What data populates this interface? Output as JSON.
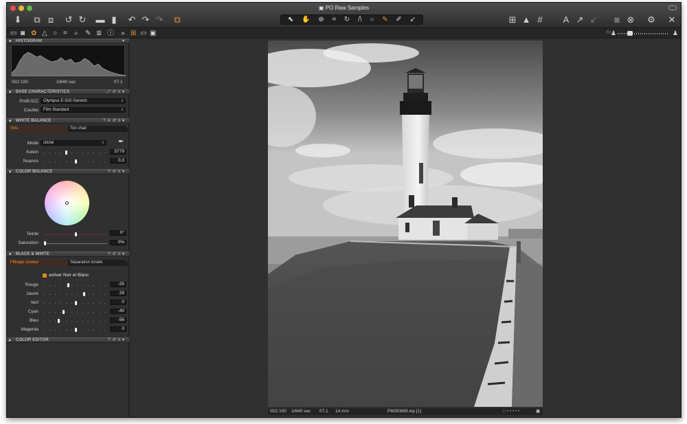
{
  "window": {
    "title": "PO Raw Samples",
    "doc_icon": "document-icon"
  },
  "toolbar": {
    "left_icons": [
      "import-icon",
      "capture-icon",
      "capture-pilot-icon",
      "rotate-left-icon",
      "rotate-right-icon",
      "new-folder-icon",
      "trash-icon",
      "undo-icon",
      "redo-icon",
      "redo-dim-icon",
      "process-icon"
    ],
    "cursor_tools": [
      "select-icon",
      "pan-icon",
      "zoom-icon",
      "crop-icon",
      "rotate-tool-icon",
      "keystone-icon",
      "spot-icon",
      "brush-icon",
      "eraser-icon",
      "picker-icon"
    ],
    "right_icons": [
      "grid-icon",
      "exposure-warning-icon",
      "grid-lines-icon",
      "text-icon",
      "arrow-up-icon",
      "arrow-down-icon",
      "camera-icon",
      "cancel-icon",
      "settings-icon",
      "tools-icon"
    ]
  },
  "toolstrip": {
    "tab_icons": [
      "folder-icon",
      "camera-tab-icon",
      "color-tab-icon",
      "exposure-tab-icon",
      "lens-tab-icon",
      "crop-tab-icon",
      "focus-tab-icon",
      "detail-tab-icon",
      "metadata-tab-icon",
      "info-tab-icon"
    ],
    "fit_label": "Fit",
    "accent": "#e6952d"
  },
  "histogram": {
    "title": "HISTOGRAM",
    "iso": "ISO 100",
    "shutter": "1/640 sec",
    "aperture": "f/7.1"
  },
  "base": {
    "title": "BASE CHARACTERISTICS",
    "icc_label": "Profil ICC",
    "icc_value": "Olympus E-520 Generic",
    "curve_label": "Courbe",
    "curve_value": "Film Standard"
  },
  "wb": {
    "title": "WHITE BALANCE",
    "tab_active": "Gris",
    "tab_inactive": "Ton chair",
    "mode_label": "Mode",
    "mode_value": "cliché",
    "kelvin_label": "Kelvin",
    "kelvin_value": "5779",
    "kelvin_level": 0.35,
    "nuance_label": "Nuance",
    "nuance_value": "0,3",
    "nuance_level": 0.5
  },
  "cb": {
    "title": "COLOR BALANCE",
    "teinte_label": "Teinte",
    "teinte_value": "0°",
    "teinte_level": 0.5,
    "saturation_label": "Saturation",
    "saturation_value": "0%",
    "saturation_level": 0.0
  },
  "bw": {
    "title": "BLACK & WHITE",
    "tab_active": "Filtrage couleur",
    "tab_inactive": "Séparation tonale",
    "enable_label": "activer Noir et Blanc",
    "rows": [
      {
        "label": "Rouge",
        "value": "-25",
        "level": 0.38
      },
      {
        "label": "Jaune",
        "value": "28",
        "level": 0.64
      },
      {
        "label": "Vert",
        "value": "0",
        "level": 0.5
      },
      {
        "label": "Cyan",
        "value": "-40",
        "level": 0.3
      },
      {
        "label": "Bleu",
        "value": "-56",
        "level": 0.22
      },
      {
        "label": "Magenta",
        "value": "0",
        "level": 0.5
      }
    ]
  },
  "color_editor": {
    "title": "COLOR EDITOR"
  },
  "viewer": {
    "iso": "ISO 100",
    "shutter": "1/640 sec",
    "aperture": "f/7.1",
    "focal": "14 mm",
    "filename": "P8050889.eip [1]"
  }
}
